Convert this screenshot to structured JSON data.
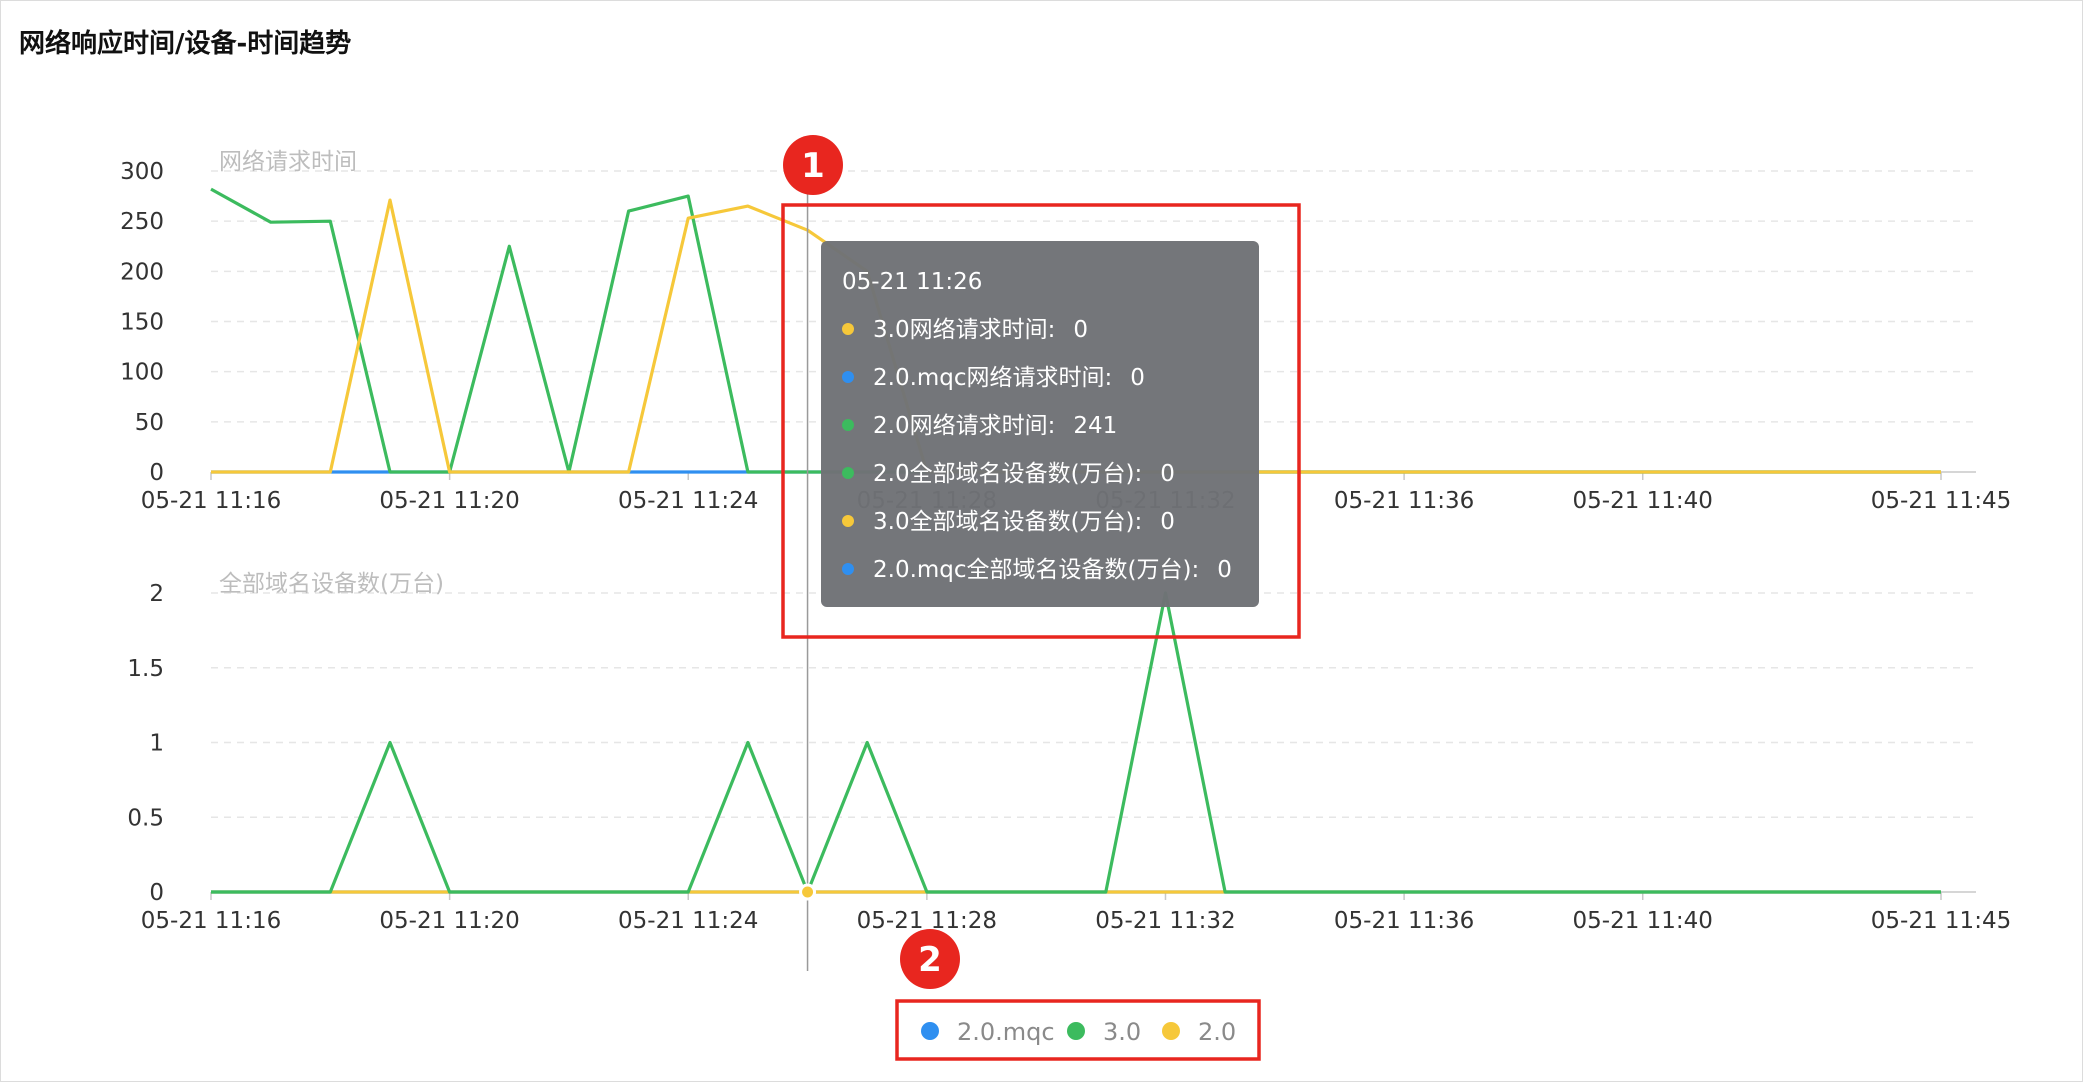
{
  "page": {
    "title": "网络响应时间/设备-时间趋势"
  },
  "chart_data": [
    {
      "type": "line",
      "title": "网络请求时间",
      "xlabel": "",
      "ylabel": "",
      "ylim": [
        0,
        300
      ],
      "y_ticks": [
        "0",
        "50",
        "100",
        "150",
        "200",
        "250",
        "300"
      ],
      "x_range": [
        "05-21 11:16",
        "05-21 11:45"
      ],
      "x_ticks": [
        "05-21 11:16",
        "05-21 11:20",
        "05-21 11:24",
        "05-21 11:28",
        "05-21 11:32",
        "05-21 11:36",
        "05-21 11:40",
        "05-21 11:45"
      ],
      "x": [
        "05-21 11:16",
        "05-21 11:17",
        "05-21 11:18",
        "05-21 11:19",
        "05-21 11:20",
        "05-21 11:21",
        "05-21 11:22",
        "05-21 11:23",
        "05-21 11:24",
        "05-21 11:25",
        "05-21 11:26",
        "05-21 11:27",
        "05-21 11:28",
        "05-21 11:29",
        "05-21 11:30",
        "05-21 11:31",
        "05-21 11:32",
        "05-21 11:33",
        "05-21 11:34",
        "05-21 11:35",
        "05-21 11:36",
        "05-21 11:37",
        "05-21 11:38",
        "05-21 11:39",
        "05-21 11:40",
        "05-21 11:41",
        "05-21 11:42",
        "05-21 11:43",
        "05-21 11:44",
        "05-21 11:45"
      ],
      "grid": true,
      "series": [
        {
          "name": "2.0.mqc",
          "color": "#2f8ff0",
          "values": [
            0,
            0,
            0,
            0,
            0,
            0,
            0,
            0,
            0,
            0,
            0,
            0,
            0,
            0,
            0,
            0,
            0,
            0,
            0,
            0,
            0,
            0,
            0,
            0,
            0,
            0,
            0,
            0,
            0,
            0
          ]
        },
        {
          "name": "3.0",
          "color": "#3cbb5e",
          "values": [
            282,
            249,
            250,
            0,
            0,
            225,
            0,
            260,
            275,
            0,
            0,
            0,
            0,
            0,
            0,
            0,
            0,
            0,
            0,
            0,
            0,
            0,
            0,
            0,
            0,
            0,
            0,
            0,
            0,
            0
          ]
        },
        {
          "name": "2.0",
          "color": "#f6c83a",
          "values": [
            0,
            0,
            0,
            271,
            0,
            0,
            0,
            0,
            253,
            265,
            241,
            200,
            0,
            0,
            0,
            0,
            0,
            0,
            0,
            0,
            0,
            0,
            0,
            0,
            0,
            0,
            0,
            0,
            0,
            0
          ]
        }
      ]
    },
    {
      "type": "line",
      "title": "全部域名设备数(万台)",
      "xlabel": "",
      "ylabel": "",
      "ylim": [
        0,
        2
      ],
      "y_ticks": [
        "0",
        "0.5",
        "1",
        "1.5",
        "2"
      ],
      "x_range": [
        "05-21 11:16",
        "05-21 11:45"
      ],
      "x_ticks": [
        "05-21 11:16",
        "05-21 11:20",
        "05-21 11:24",
        "05-21 11:28",
        "05-21 11:32",
        "05-21 11:36",
        "05-21 11:40",
        "05-21 11:45"
      ],
      "x": [
        "05-21 11:16",
        "05-21 11:17",
        "05-21 11:18",
        "05-21 11:19",
        "05-21 11:20",
        "05-21 11:21",
        "05-21 11:22",
        "05-21 11:23",
        "05-21 11:24",
        "05-21 11:25",
        "05-21 11:26",
        "05-21 11:27",
        "05-21 11:28",
        "05-21 11:29",
        "05-21 11:30",
        "05-21 11:31",
        "05-21 11:32",
        "05-21 11:33",
        "05-21 11:34",
        "05-21 11:35",
        "05-21 11:36",
        "05-21 11:37",
        "05-21 11:38",
        "05-21 11:39",
        "05-21 11:40",
        "05-21 11:41",
        "05-21 11:42",
        "05-21 11:43",
        "05-21 11:44",
        "05-21 11:45"
      ],
      "grid": true,
      "series": [
        {
          "name": "2.0.mqc",
          "color": "#2f8ff0",
          "values": [
            0,
            0,
            0,
            0,
            0,
            0,
            0,
            0,
            0,
            0,
            0,
            0,
            0,
            0,
            0,
            0,
            0,
            0,
            0,
            0,
            0,
            0,
            0,
            0,
            0,
            0,
            0,
            0,
            0,
            0
          ]
        },
        {
          "name": "3.0",
          "color": "#3cbb5e",
          "values": [
            0,
            0,
            0,
            1,
            0,
            0,
            0,
            0,
            0,
            1,
            0,
            1,
            0,
            0,
            0,
            0,
            2,
            0,
            0,
            0,
            0,
            0,
            0,
            0,
            0,
            0,
            0,
            0,
            0,
            0
          ]
        },
        {
          "name": "2.0",
          "color": "#f6c83a",
          "values": [
            0,
            0,
            0,
            0,
            0,
            0,
            0,
            0,
            0,
            0,
            0,
            0,
            0,
            0,
            0,
            0,
            0,
            0,
            0,
            0,
            0,
            0,
            0,
            0,
            0,
            0,
            0,
            0,
            0,
            0
          ]
        }
      ]
    }
  ],
  "tooltip": {
    "time": "05-21 11:26",
    "rows": [
      {
        "label": "3.0网络请求时间:",
        "value": "0",
        "color": "#f6c83a"
      },
      {
        "label": "2.0.mqc网络请求时间:",
        "value": "0",
        "color": "#2f8ff0"
      },
      {
        "label": "2.0网络请求时间:",
        "value": "241",
        "color": "#3cbb5e"
      },
      {
        "label": "2.0全部域名设备数(万台):",
        "value": "0",
        "color": "#3cbb5e"
      },
      {
        "label": "3.0全部域名设备数(万台):",
        "value": "0",
        "color": "#f6c83a"
      },
      {
        "label": "2.0.mqc全部域名设备数(万台):",
        "value": "0",
        "color": "#2f8ff0"
      }
    ]
  },
  "legend": {
    "items": [
      {
        "name": "2.0.mqc",
        "color": "#2f8ff0"
      },
      {
        "name": "3.0",
        "color": "#3cbb5e"
      },
      {
        "name": "2.0",
        "color": "#f6c83a"
      }
    ]
  },
  "annotations": {
    "badges": [
      "1",
      "2"
    ],
    "badge_color": "#e8261f"
  }
}
